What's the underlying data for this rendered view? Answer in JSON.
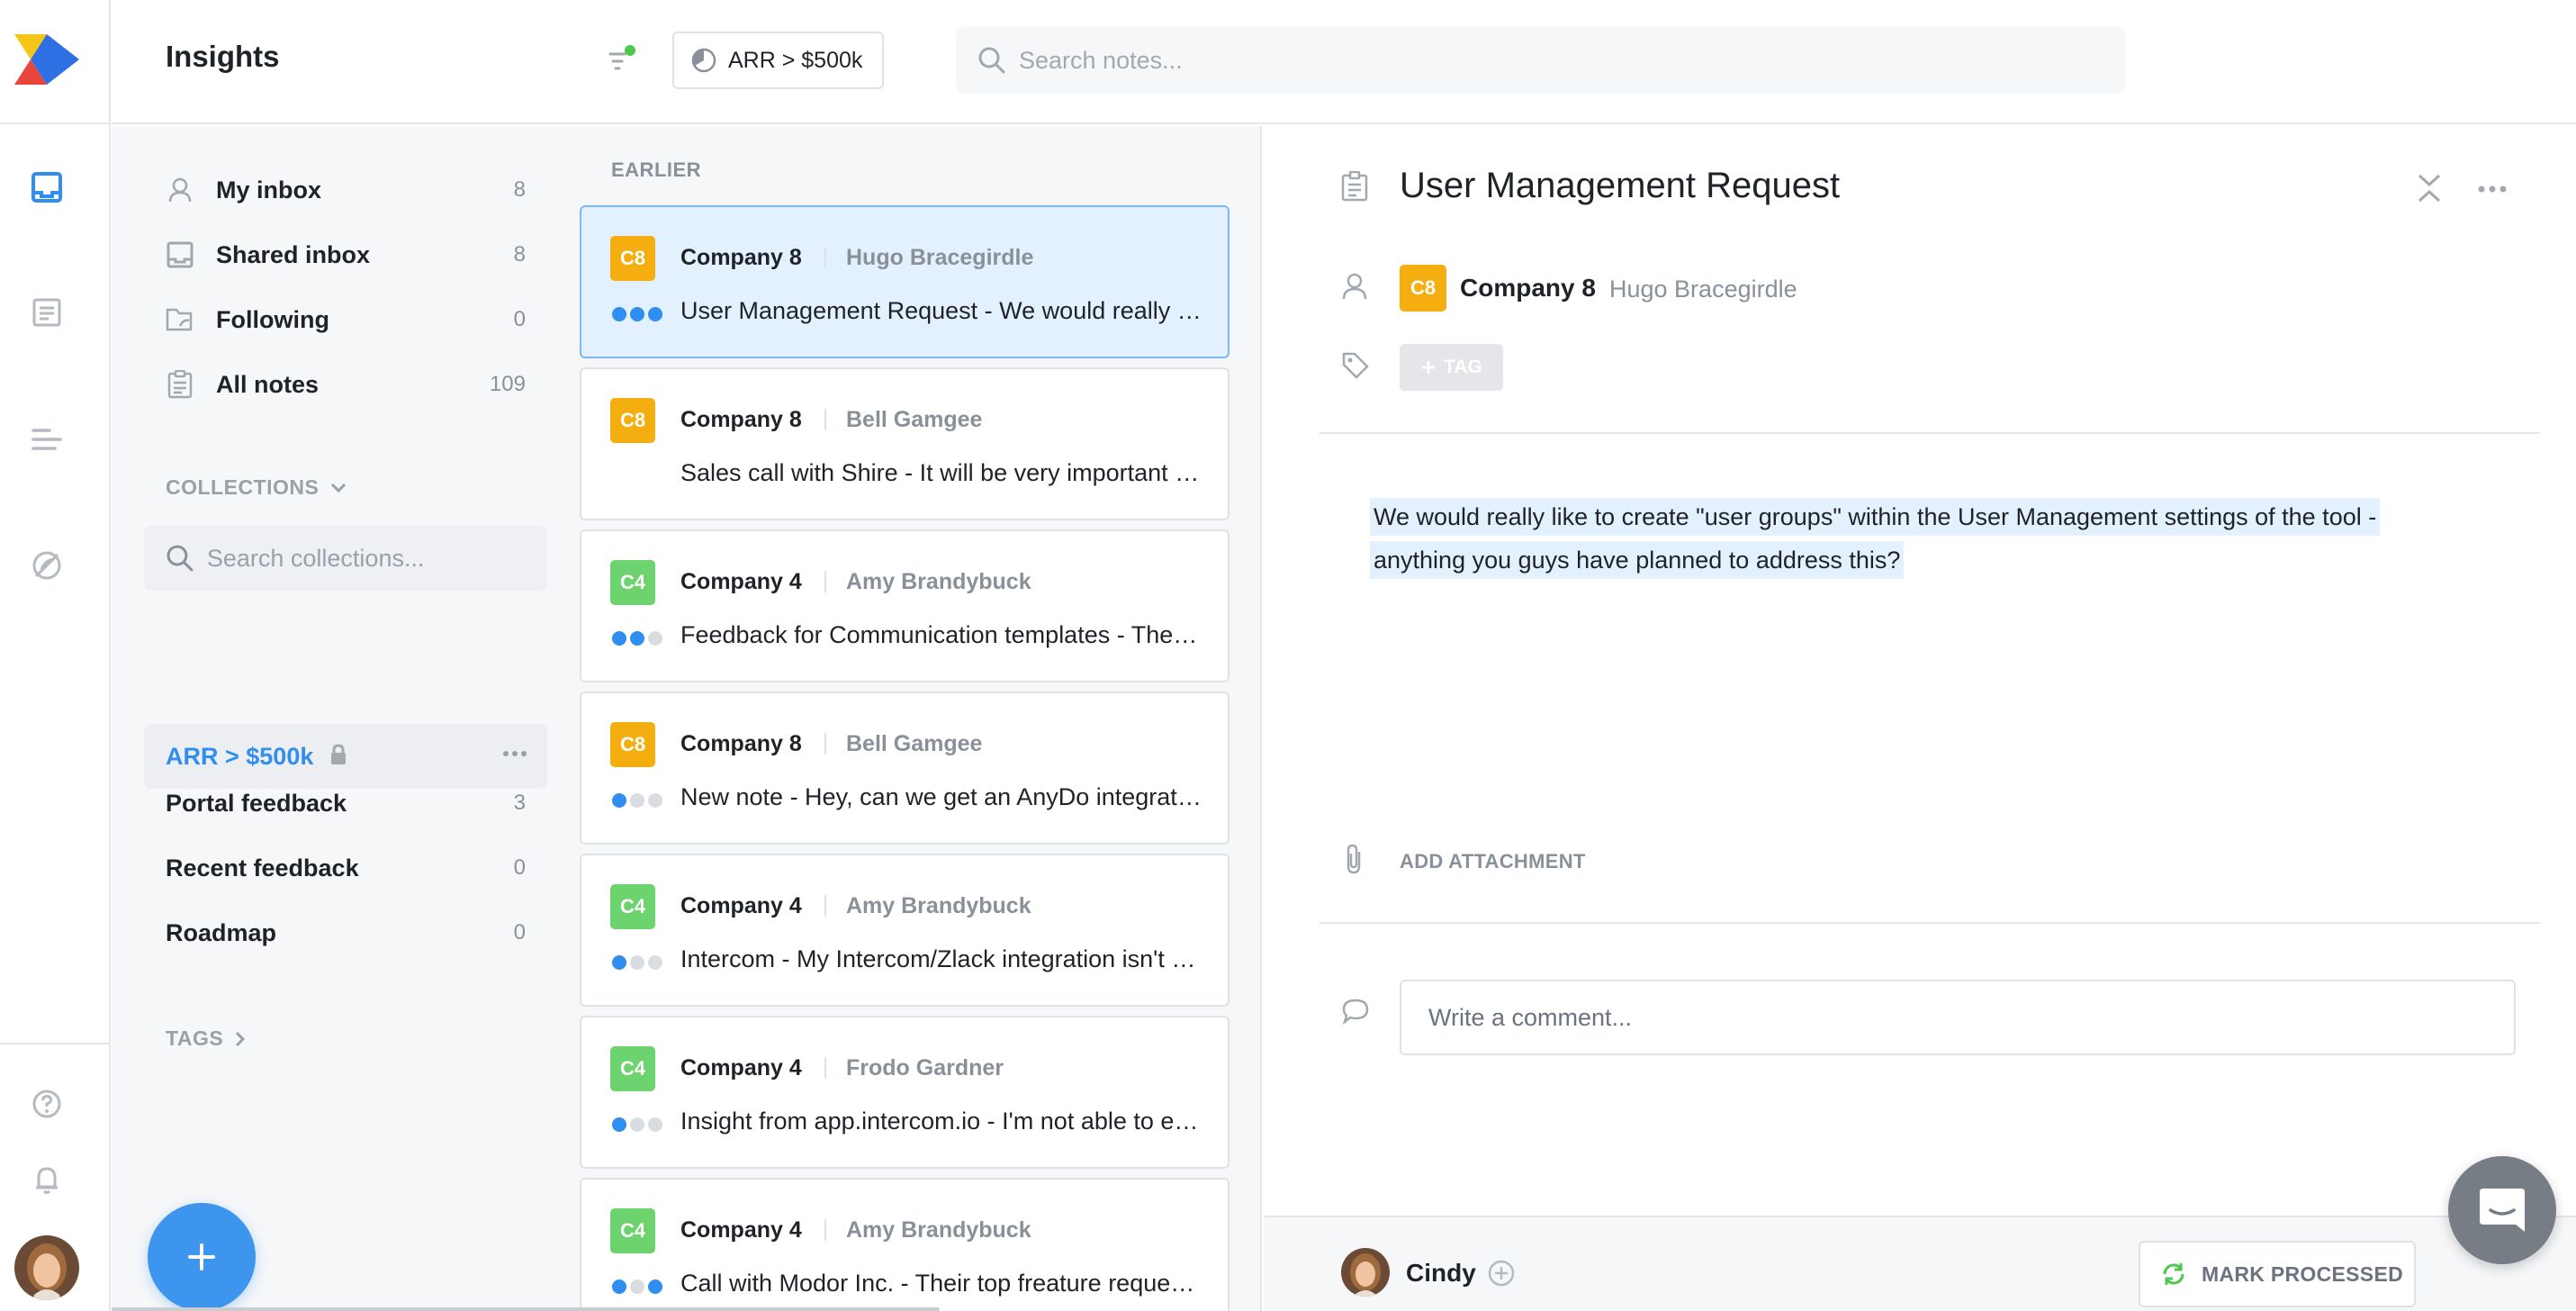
{
  "app": {
    "title": "Insights",
    "filter_chip": "ARR > $500k",
    "search_placeholder": "Search notes..."
  },
  "nav": {
    "items": [
      {
        "label": "My inbox",
        "count": "8",
        "icon": "user-icon"
      },
      {
        "label": "Shared inbox",
        "count": "8",
        "icon": "inbox-icon"
      },
      {
        "label": "Following",
        "count": "0",
        "icon": "following-icon"
      },
      {
        "label": "All notes",
        "count": "109",
        "icon": "clipboard-icon"
      }
    ],
    "collections_label": "COLLECTIONS",
    "collections_search_placeholder": "Search collections...",
    "active_collection": "ARR > $500k",
    "collections": [
      {
        "label": "Portal feedback",
        "count": "3"
      },
      {
        "label": "Recent feedback",
        "count": "0"
      },
      {
        "label": "Roadmap",
        "count": "0"
      }
    ],
    "tags_label": "TAGS"
  },
  "notes": {
    "group_label": "EARLIER",
    "cards": [
      {
        "badge": "C8",
        "badge_color": "#f5ae10",
        "company": "Company 8",
        "person": "Hugo Bracegirdle",
        "snippet": "User Management Request - We would really like to create user groups",
        "dots": [
          "#2f8ef0",
          "#2f8ef0",
          "#2f8ef0"
        ],
        "selected": true
      },
      {
        "badge": "C8",
        "badge_color": "#f5ae10",
        "company": "Company 8",
        "person": "Bell Gamgee",
        "snippet": "Sales call with Shire - It will be very important to have this",
        "dots": [],
        "selected": false
      },
      {
        "badge": "C4",
        "badge_color": "#6dd36f",
        "company": "Company 4",
        "person": "Amy Brandybuck",
        "snippet": "Feedback for Communication templates - The templates are",
        "dots": [
          "#2f8ef0",
          "#2f8ef0",
          "#d9dde2"
        ],
        "selected": false
      },
      {
        "badge": "C8",
        "badge_color": "#f5ae10",
        "company": "Company 8",
        "person": "Bell Gamgee",
        "snippet": "New note - Hey, can we get an AnyDo integration please?",
        "dots": [
          "#2f8ef0",
          "#d9dde2",
          "#d9dde2"
        ],
        "selected": false
      },
      {
        "badge": "C4",
        "badge_color": "#6dd36f",
        "company": "Company 4",
        "person": "Amy Brandybuck",
        "snippet": "Intercom - My Intercom/Zlack integration isn't working",
        "dots": [
          "#2f8ef0",
          "#d9dde2",
          "#d9dde2"
        ],
        "selected": false
      },
      {
        "badge": "C4",
        "badge_color": "#6dd36f",
        "company": "Company 4",
        "person": "Frodo Gardner",
        "snippet": "Insight from app.intercom.io - I'm not able to export",
        "dots": [
          "#2f8ef0",
          "#d9dde2",
          "#d9dde2"
        ],
        "selected": false
      },
      {
        "badge": "C4",
        "badge_color": "#6dd36f",
        "company": "Company 4",
        "person": "Amy Brandybuck",
        "snippet": "Call with Modor Inc. - Their top freature request is",
        "dots": [
          "#2f8ef0",
          "#d9dde2",
          "#2f8ef0"
        ],
        "selected": false
      }
    ]
  },
  "detail": {
    "title": "User Management Request",
    "badge": "C8",
    "company": "Company 8",
    "person": "Hugo Bracegirdle",
    "tag_button": "TAG",
    "body": "We would really like to create \"user groups\" within the User Management settings of the tool - anything you guys have planned to address this?",
    "add_attachment": "ADD ATTACHMENT",
    "comment_placeholder": "Write a comment...",
    "owner": "Cindy",
    "mark_processed": "MARK PROCESSED"
  },
  "colors": {
    "accent": "#2f8ef0",
    "badge_c8": "#f5ae10",
    "badge_c4": "#6dd36f",
    "fab": "#3d95ee"
  }
}
